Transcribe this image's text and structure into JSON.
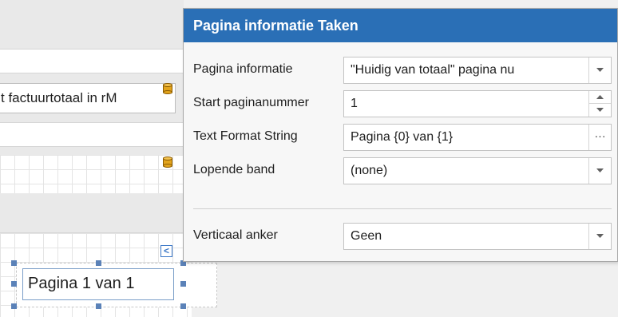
{
  "designer": {
    "field_invoice_text": "t factuurtotaal in rM",
    "page_info_text": "Pagina 1 van 1",
    "smart_tag_glyph": "<"
  },
  "panel": {
    "title": "Pagina informatie Taken",
    "rows": [
      {
        "label": "Pagina informatie",
        "value": "\"Huidig van totaal\" pagina nu",
        "editor": "dropdown"
      },
      {
        "label": "Start paginanummer",
        "value": "1",
        "editor": "spinner"
      },
      {
        "label": "Text Format String",
        "value": "Pagina {0} van {1}",
        "editor": "ellipsis",
        "button_label": "···"
      },
      {
        "label": "Lopende band",
        "value": "(none)",
        "editor": "dropdown"
      },
      {
        "label": "Verticaal anker",
        "value": "Geen",
        "editor": "dropdown"
      }
    ]
  },
  "colors": {
    "title_bar": "#2a6fb6",
    "selection_handle": "#5b82b8",
    "db_icon": "#e3a41c"
  }
}
